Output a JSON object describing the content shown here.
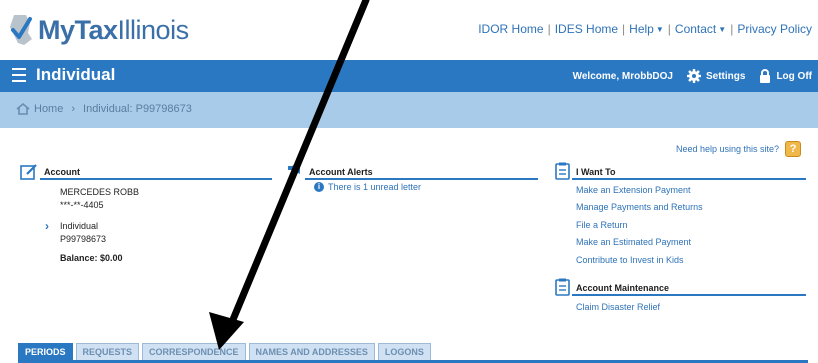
{
  "header": {
    "logo": {
      "my": "My",
      "tax": "Tax",
      "illinois": "Illinois"
    },
    "links": [
      {
        "label": "IDOR Home",
        "dropdown": false
      },
      {
        "label": "IDES Home",
        "dropdown": false
      },
      {
        "label": "Help",
        "dropdown": true
      },
      {
        "label": "Contact",
        "dropdown": true
      },
      {
        "label": "Privacy Policy",
        "dropdown": false
      }
    ]
  },
  "bar": {
    "title": "Individual",
    "welcome": "Welcome, MrobbDOJ",
    "settings": "Settings",
    "logoff": "Log Off"
  },
  "breadcrumb": {
    "home": "Home",
    "current": "Individual: P99798673"
  },
  "help": {
    "label": "Need help using this site?",
    "icon": "?"
  },
  "account": {
    "heading": "Account",
    "name": "MERCEDES ROBB",
    "ssn": "***-**-4405",
    "type": "Individual",
    "id": "P99798673",
    "balance": "Balance: $0.00"
  },
  "alerts": {
    "heading": "Account Alerts",
    "message": "There is 1 unread letter"
  },
  "iwantto": {
    "heading": "I Want To",
    "items": [
      "Make an Extension Payment",
      "Manage Payments and Returns",
      "File a Return",
      "Make an Estimated Payment",
      "Contribute to Invest in Kids"
    ]
  },
  "maintenance": {
    "heading": "Account Maintenance",
    "items": [
      "Claim Disaster Relief"
    ]
  },
  "tabs": [
    {
      "label": "PERIODS",
      "active": true
    },
    {
      "label": "REQUESTS",
      "active": false
    },
    {
      "label": "CORRESPONDENCE",
      "active": false
    },
    {
      "label": "NAMES AND ADDRESSES",
      "active": false
    },
    {
      "label": "LOGONS",
      "active": false
    }
  ],
  "colors": {
    "primary": "#2b78c2",
    "breadcrumb_bg": "#a7cbe9",
    "link": "#2f73b8",
    "arrow": "#000000"
  },
  "icons": {
    "logo": "checkmark-state-icon",
    "menu": "hamburger-icon",
    "settings": "gear-icon",
    "logoff": "padlock-icon",
    "home": "house-icon",
    "account": "pencil-edit-icon",
    "alerts": "megaphone-icon",
    "iwantto": "clipboard-icon",
    "maintenance": "clipboard-icon",
    "alert_item": "info-icon",
    "annotation": "arrow-icon"
  }
}
